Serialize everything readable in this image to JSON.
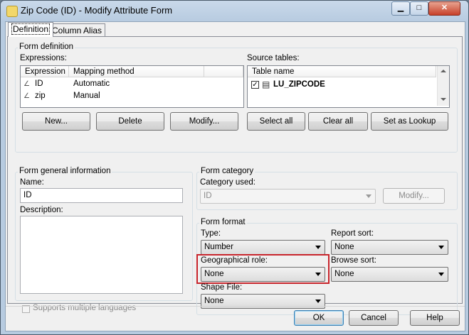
{
  "window": {
    "title": "Zip Code (ID) - Modify Attribute Form"
  },
  "tabs": [
    {
      "label": "Definition"
    },
    {
      "label": "Column Alias"
    }
  ],
  "form_definition": {
    "label": "Form definition",
    "expressions_label": "Expressions:",
    "expr_columns": [
      "Expression",
      "Mapping method"
    ],
    "expressions": [
      {
        "expression": "ID",
        "mapping": "Automatic"
      },
      {
        "expression": "zip",
        "mapping": "Manual"
      }
    ],
    "source_tables_label": "Source tables:",
    "table_column": "Table name",
    "tables": [
      {
        "name": "LU_ZIPCODE",
        "checked": true
      }
    ],
    "buttons": {
      "new": "New...",
      "delete": "Delete",
      "modify": "Modify...",
      "select_all": "Select all",
      "clear_all": "Clear all",
      "set_lookup": "Set as Lookup"
    }
  },
  "general": {
    "label": "Form general information",
    "name_label": "Name:",
    "name_value": "ID",
    "description_label": "Description:",
    "description_value": "",
    "multilang_label": "Supports multiple languages"
  },
  "category": {
    "label": "Form category",
    "used_label": "Category used:",
    "used_value": "ID",
    "modify_button": "Modify..."
  },
  "format": {
    "label": "Form format",
    "type_label": "Type:",
    "type_value": "Number",
    "report_sort_label": "Report sort:",
    "report_sort_value": "None",
    "geo_role_label": "Geographical role:",
    "geo_role_value": "None",
    "browse_sort_label": "Browse sort:",
    "browse_sort_value": "None",
    "shape_file_label": "Shape File:",
    "shape_file_value": "None"
  },
  "footer": {
    "ok": "OK",
    "cancel": "Cancel",
    "help": "Help"
  },
  "colors": {
    "highlight": "#c8252c",
    "titlebar": "#b7cbe0"
  }
}
